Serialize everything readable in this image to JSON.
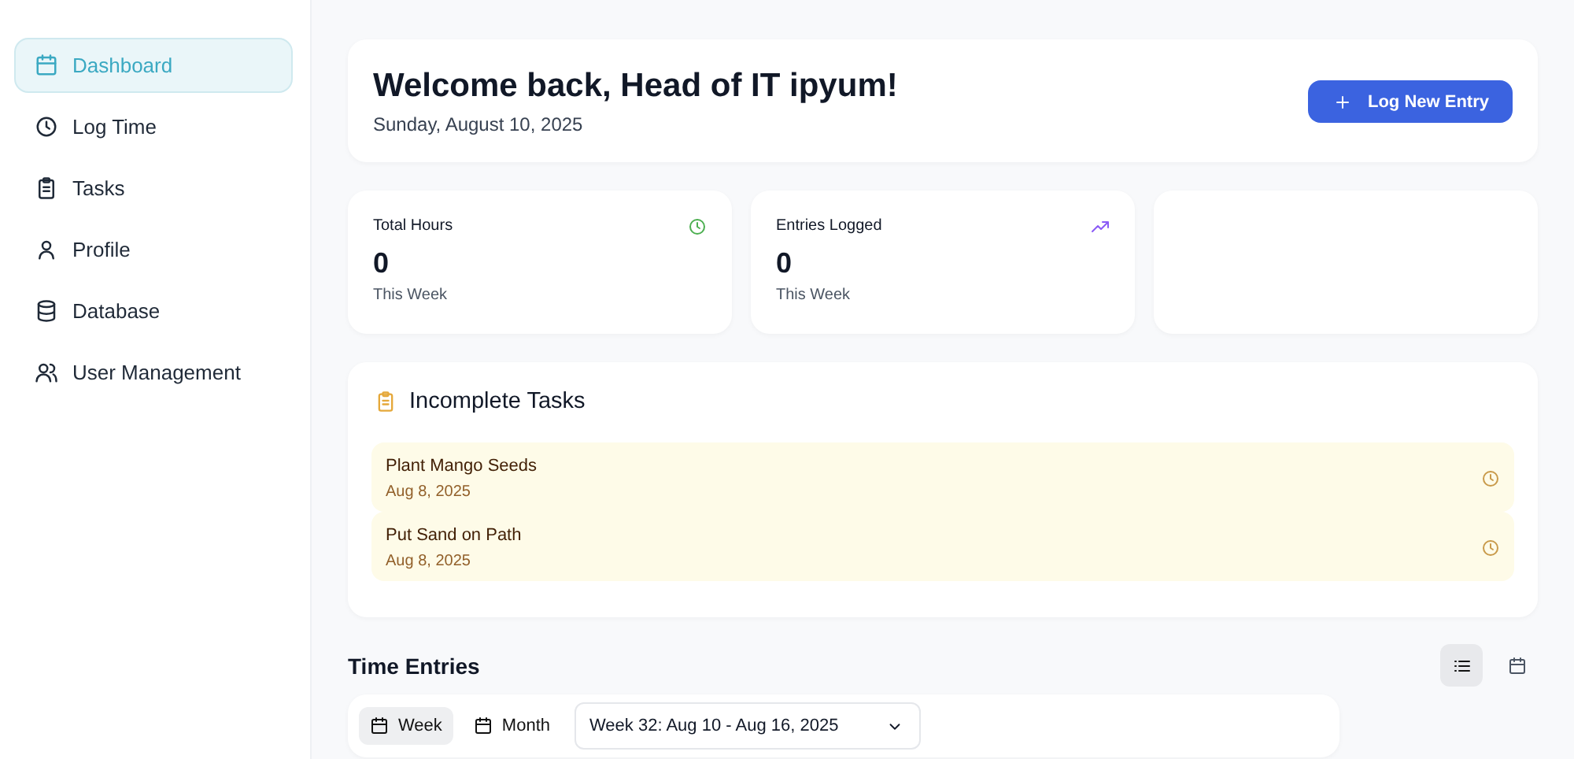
{
  "sidebar": {
    "items": [
      {
        "label": "Dashboard",
        "kind": "calendar",
        "selected": true
      },
      {
        "label": "Log Time",
        "kind": "clock",
        "selected": false
      },
      {
        "label": "Tasks",
        "kind": "clipboard",
        "selected": false
      },
      {
        "label": "Profile",
        "kind": "user",
        "selected": false
      },
      {
        "label": "Database",
        "kind": "database",
        "selected": false
      },
      {
        "label": "User Management",
        "kind": "users",
        "selected": false
      }
    ]
  },
  "header": {
    "title": "Welcome back, Head of IT ipyum!",
    "date": "Sunday, August 10, 2025",
    "button": "Log New Entry"
  },
  "stats": [
    {
      "label": "Total Hours",
      "value": "0",
      "caption": "This Week",
      "kind": "clock",
      "color": "#4caf50"
    },
    {
      "label": "Entries Logged",
      "value": "0",
      "caption": "This Week",
      "kind": "trend",
      "color": "#8b5cf6"
    }
  ],
  "incomplete_tasks": {
    "title": "Incomplete Tasks",
    "items": [
      {
        "name": "Plant Mango Seeds",
        "date": "Aug 8, 2025"
      },
      {
        "name": "Put Sand on Path",
        "date": "Aug 8, 2025"
      }
    ]
  },
  "time_entries": {
    "title": "Time Entries",
    "views": [
      {
        "kind": "list",
        "selected": true
      },
      {
        "kind": "calendar",
        "selected": false
      }
    ],
    "periods": [
      {
        "label": "Week",
        "selected": true
      },
      {
        "label": "Month",
        "selected": false
      }
    ],
    "range": "Week 32: Aug 10 - Aug 16, 2025"
  }
}
